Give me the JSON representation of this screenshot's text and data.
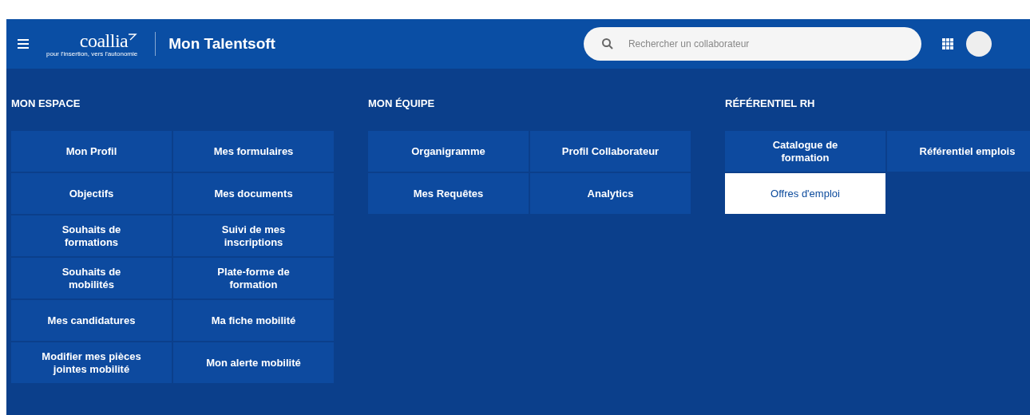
{
  "header": {
    "logo": {
      "name": "coallia",
      "tagline": "pour l'insertion, vers l'autonomie"
    },
    "app_title": "Mon Talentsoft",
    "search": {
      "placeholder": "Rechercher un collaborateur"
    }
  },
  "sections": [
    {
      "title": "MON ESPACE",
      "items": [
        {
          "label": "Mon Profil",
          "selected": false
        },
        {
          "label": "Mes formulaires",
          "selected": false
        },
        {
          "label": "Objectifs",
          "selected": false
        },
        {
          "label": "Mes documents",
          "selected": false
        },
        {
          "label": "Souhaits de formations",
          "selected": false
        },
        {
          "label": "Suivi de mes inscriptions",
          "selected": false
        },
        {
          "label": "Souhaits de mobilités",
          "selected": false
        },
        {
          "label": "Plate-forme de formation",
          "selected": false
        },
        {
          "label": "Mes candidatures",
          "selected": false
        },
        {
          "label": "Ma fiche mobilité",
          "selected": false
        },
        {
          "label": "Modifier mes pièces jointes mobilité",
          "selected": false
        },
        {
          "label": "Mon alerte mobilité",
          "selected": false
        }
      ]
    },
    {
      "title": "MON ÉQUIPE",
      "items": [
        {
          "label": "Organigramme",
          "selected": false
        },
        {
          "label": "Profil Collaborateur",
          "selected": false
        },
        {
          "label": "Mes Requêtes",
          "selected": false
        },
        {
          "label": "Analytics",
          "selected": false
        }
      ]
    },
    {
      "title": "RÉFÉRENTIEL RH",
      "items": [
        {
          "label": "Catalogue de formation",
          "selected": false
        },
        {
          "label": "Référentiel emplois",
          "selected": false
        },
        {
          "label": "Offres d'emploi",
          "selected": true
        }
      ]
    }
  ]
}
